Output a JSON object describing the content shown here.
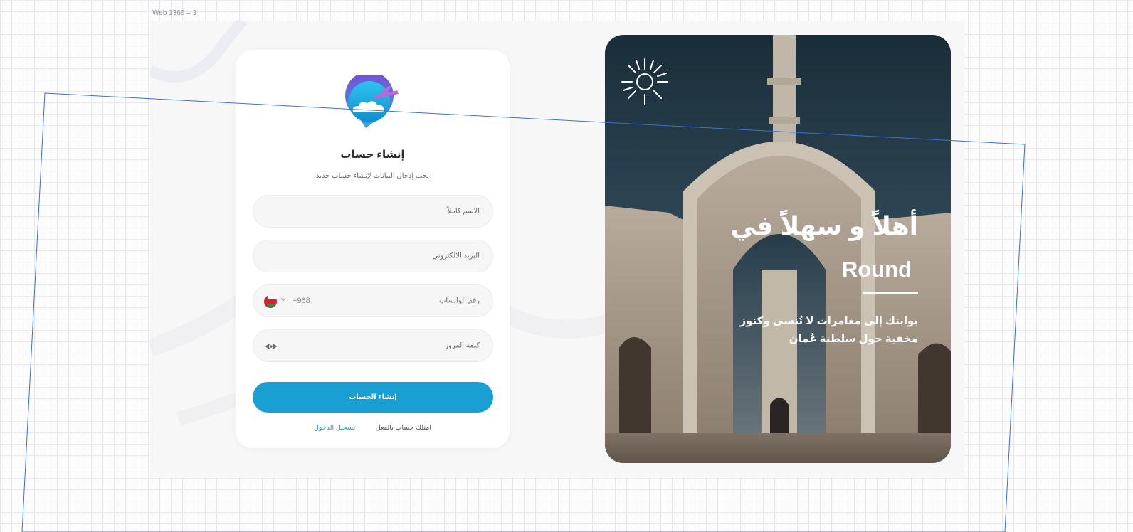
{
  "frame": {
    "label": "Web 1366 – 3"
  },
  "form": {
    "title": "إنشاء حساب",
    "subtitle": "يجب إدخال البيانات لإنشاء حساب جديد",
    "fields": {
      "full_name": {
        "placeholder": "الاسم كاملاً"
      },
      "email": {
        "placeholder": "البريد الالكتروني"
      },
      "whatsapp": {
        "placeholder": "رقم الواتساب",
        "country_code": "+968",
        "country_flag": "oman-flag-icon"
      },
      "password": {
        "placeholder": "كلمة المرور",
        "toggle_icon": "eye-icon"
      }
    },
    "submit_label": "إنشاء الحساب",
    "login_prompt": "امتلك حساب بالفعل",
    "login_link": "تسجيل الدخول"
  },
  "hero": {
    "welcome": "أهلاً و سهلاً في",
    "brand": "Round",
    "tagline": "بوابتك إلى مغامرات لا تُنسى وكنوز مخفية حول سلطنة عُمان",
    "icon": "sun-icon"
  },
  "colors": {
    "accent": "#1a9fd3",
    "artboard_bg": "#f7f7f8",
    "card_bg": "#ffffff",
    "field_bg": "#f6f6f7",
    "selection_outline": "#3b6fd8"
  }
}
